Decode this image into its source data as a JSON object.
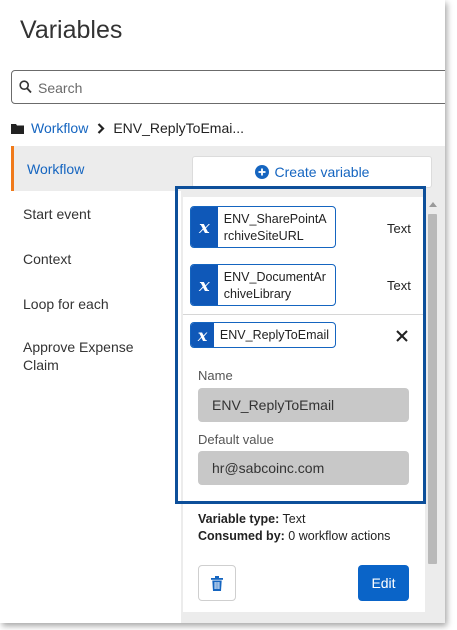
{
  "title": "Variables",
  "search": {
    "placeholder": "Search",
    "icon": "search-icon"
  },
  "breadcrumb": {
    "folder_icon": "folder-icon",
    "root": "Workflow",
    "separator_icon": "chevron-right-icon",
    "current": "ENV_ReplyToEmai..."
  },
  "sidebar": {
    "items": [
      {
        "label": "Workflow",
        "active": true
      },
      {
        "label": "Start event",
        "active": false
      },
      {
        "label": "Context",
        "active": false
      },
      {
        "label": "Loop for each",
        "active": false
      },
      {
        "label": "Approve Expense Claim",
        "active": false
      }
    ]
  },
  "main": {
    "create_label": "Create variable",
    "variables": [
      {
        "name": "ENV_SharePointArchiveSiteURL",
        "type": "Text"
      },
      {
        "name": "ENV_DocumentArchiveLibrary",
        "type": "Text"
      }
    ],
    "selected": {
      "name": "ENV_ReplyToEmail",
      "name_label": "Name",
      "name_value": "ENV_ReplyToEmail",
      "default_label": "Default value",
      "default_value": "hr@sabcoinc.com",
      "type_label": "Variable type:",
      "type_value": "Text",
      "consumed_label": "Consumed by:",
      "consumed_value": "0 workflow actions",
      "edit_label": "Edit"
    }
  },
  "colors": {
    "accent": "#1565c0",
    "active_border": "#f07a1a",
    "badge": "#0f58b8",
    "edit_button": "#0a64c8",
    "highlight": "#0d4f9a"
  }
}
